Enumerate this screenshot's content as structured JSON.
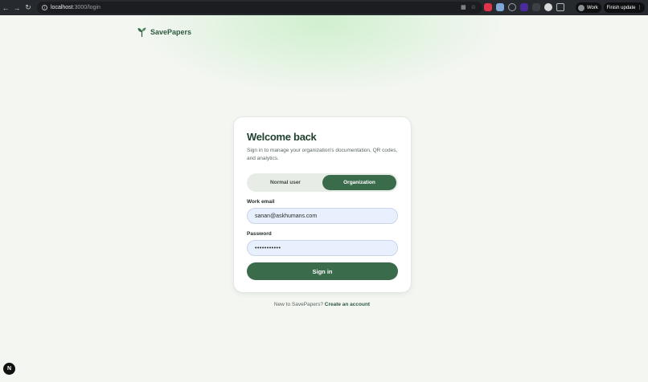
{
  "browser": {
    "url_host": "localhost",
    "url_path": ":3000/login",
    "profile_label": "Work",
    "update_label": "Finish update",
    "colors": {
      "chrome": "#26292d",
      "omnibox": "#1b1d20"
    }
  },
  "brand": {
    "name": "SavePapers",
    "logo_icon": "sprout-icon"
  },
  "login": {
    "title": "Welcome back",
    "subtitle": "Sign in to manage your organization's documentation, QR codes, and analytics.",
    "toggle": {
      "normal_label": "Normal user",
      "org_label": "Organization",
      "selected": "Organization"
    },
    "email_label": "Work email",
    "email_value": "sanan@askhumans.com",
    "password_label": "Password",
    "password_value": "•••••••••••",
    "submit_label": "Sign in"
  },
  "footer": {
    "prompt": "New to SavePapers?",
    "link": "Create an account"
  },
  "dev_badge": "N",
  "colors": {
    "primary": "#3a6b4b",
    "background": "#f4f6f2"
  }
}
